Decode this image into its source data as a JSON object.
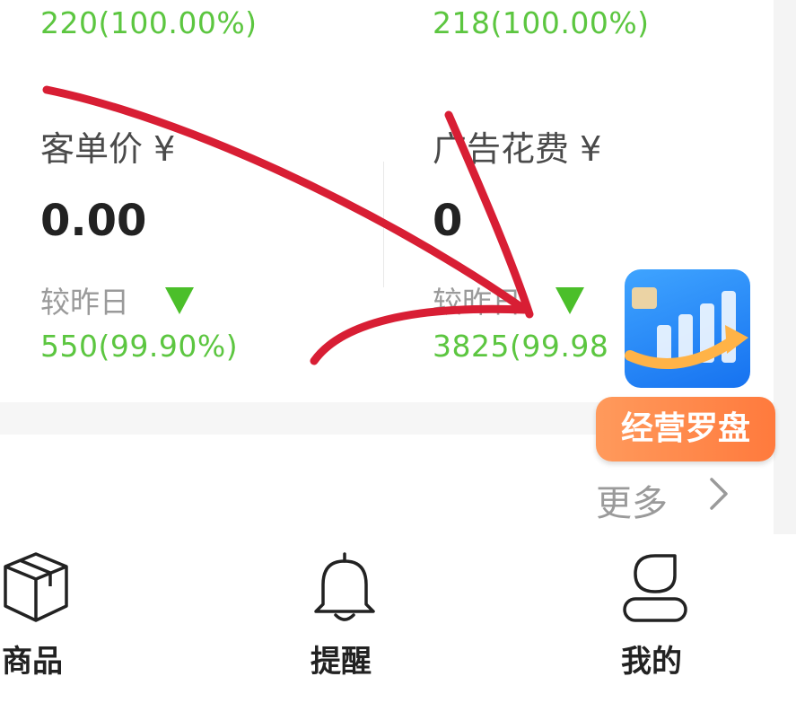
{
  "stats": {
    "top_left_change": "220(100.00%)",
    "top_right_change": "218(100.00%)",
    "avg_order": {
      "label": "客单价 ¥",
      "value": "0.00",
      "compare_label": "较昨日",
      "change": "550(99.90%)",
      "trend": "down"
    },
    "ad_spend": {
      "label": "广告花费 ¥",
      "value": "0",
      "compare_label": "较昨日",
      "change": "3825(99.98",
      "trend": "down"
    },
    "trend_color": "#4bbf2a",
    "change_color": "#5cc640"
  },
  "badge": {
    "label": "经营罗盘",
    "icon": "bar-chart-arrow-icon"
  },
  "more_link": {
    "label": "更多",
    "icon": "chevron-right-icon"
  },
  "tabbar": {
    "items": [
      {
        "label": "商品",
        "icon": "box-icon"
      },
      {
        "label": "提醒",
        "icon": "bell-icon"
      },
      {
        "label": "我的",
        "icon": "user-icon"
      }
    ]
  },
  "annotation_color": "#d81e34"
}
